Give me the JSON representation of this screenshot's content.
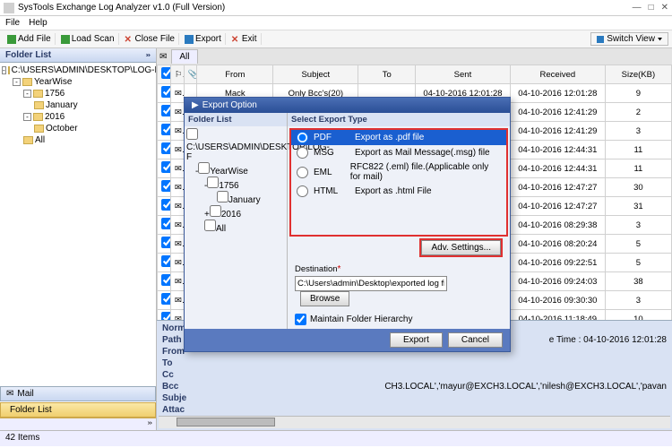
{
  "titlebar": {
    "app": "SysTools Exchange Log Analyzer v1.0 (Full Version)"
  },
  "menu": {
    "file": "File",
    "help": "Help"
  },
  "toolbar": {
    "addfile": "Add File",
    "loadscan": "Load Scan",
    "closefile": "Close File",
    "export": "Export",
    "exit": "Exit",
    "switchview": "Switch View"
  },
  "sidebar": {
    "header": "Folder List",
    "root": "C:\\USERS\\ADMIN\\DESKTOP\\LOG-FILE\\DIFFERENT",
    "yearwise": "YearWise",
    "y1756": "1756",
    "jan": "January",
    "y2016": "2016",
    "oct": "October",
    "all": "All",
    "mail": "Mail",
    "folderlist": "Folder List"
  },
  "tab": "All",
  "columns": {
    "from": "From",
    "subject": "Subject",
    "to": "To",
    "sent": "Sent",
    "received": "Received",
    "size": "Size(KB)"
  },
  "rows": [
    {
      "from": "Mack",
      "subject": "Only Bcc's(20)",
      "to": "",
      "sent": "04-10-2016 12:01:28",
      "received": "04-10-2016 12:01:28",
      "size": "9"
    },
    {
      "from": "",
      "subject": "",
      "to": "",
      "sent": "",
      "received": "04-10-2016 12:41:29",
      "size": "2"
    },
    {
      "from": "",
      "subject": "",
      "to": "",
      "sent": "",
      "received": "04-10-2016 12:41:29",
      "size": "3"
    },
    {
      "from": "",
      "subject": "",
      "to": "",
      "sent": "",
      "received": "04-10-2016 12:44:31",
      "size": "11"
    },
    {
      "from": "",
      "subject": "",
      "to": "",
      "sent": "",
      "received": "04-10-2016 12:44:31",
      "size": "11"
    },
    {
      "from": "",
      "subject": "",
      "to": "",
      "sent": "",
      "received": "04-10-2016 12:47:27",
      "size": "30"
    },
    {
      "from": "",
      "subject": "",
      "to": "",
      "sent": "",
      "received": "04-10-2016 12:47:27",
      "size": "31"
    },
    {
      "from": "",
      "subject": "",
      "to": "",
      "sent": "",
      "received": "04-10-2016 08:29:38",
      "size": "3"
    },
    {
      "from": "",
      "subject": "",
      "to": "",
      "sent": "",
      "received": "04-10-2016 08:20:24",
      "size": "5"
    },
    {
      "from": "",
      "subject": "",
      "to": "",
      "sent": "",
      "received": "04-10-2016 09:22:51",
      "size": "5"
    },
    {
      "from": "",
      "subject": "",
      "to": "",
      "sent": "",
      "received": "04-10-2016 09:24:03",
      "size": "38"
    },
    {
      "from": "",
      "subject": "",
      "to": "",
      "sent": "",
      "received": "04-10-2016 09:30:30",
      "size": "3"
    },
    {
      "from": "",
      "subject": "",
      "to": "",
      "sent": "",
      "received": "04-10-2016 11:18:49",
      "size": "10"
    }
  ],
  "details": {
    "norm": "Norm",
    "path": "Path",
    "from": "From",
    "to": "To",
    "cc": "Cc",
    "bcc": "Bcc",
    "subj": "Subje",
    "attac": "Attac",
    "etime_label": "e Time :",
    "etime": "04-10-2016 12:01:28",
    "cc_val": "CH3.LOCAL','mayur@EXCH3.LOCAL','nilesh@EXCH3.LOCAL','pavan"
  },
  "modal": {
    "title": "Export Option",
    "folderlist": "Folder List",
    "root": "C:\\USERS\\ADMIN\\DESKTOP\\LOG-F",
    "yearwise": "YearWise",
    "y1756": "1756",
    "jan": "January",
    "y2016": "2016",
    "all": "All",
    "selecttype": "Select Export Type",
    "opts": [
      {
        "name": "PDF",
        "desc": "Export as .pdf file"
      },
      {
        "name": "MSG",
        "desc": "Export as Mail Message(.msg) file"
      },
      {
        "name": "EML",
        "desc": "RFC822 (.eml) file.(Applicable only for mail)"
      },
      {
        "name": "HTML",
        "desc": "Export as .html File"
      }
    ],
    "adv": "Adv. Settings...",
    "destlabel": "Destination",
    "destval": "C:\\Users\\admin\\Desktop\\exported log file",
    "browse": "Browse",
    "maintain": "Maintain Folder Hierarchy",
    "export": "Export",
    "cancel": "Cancel"
  },
  "status": "42 Items"
}
